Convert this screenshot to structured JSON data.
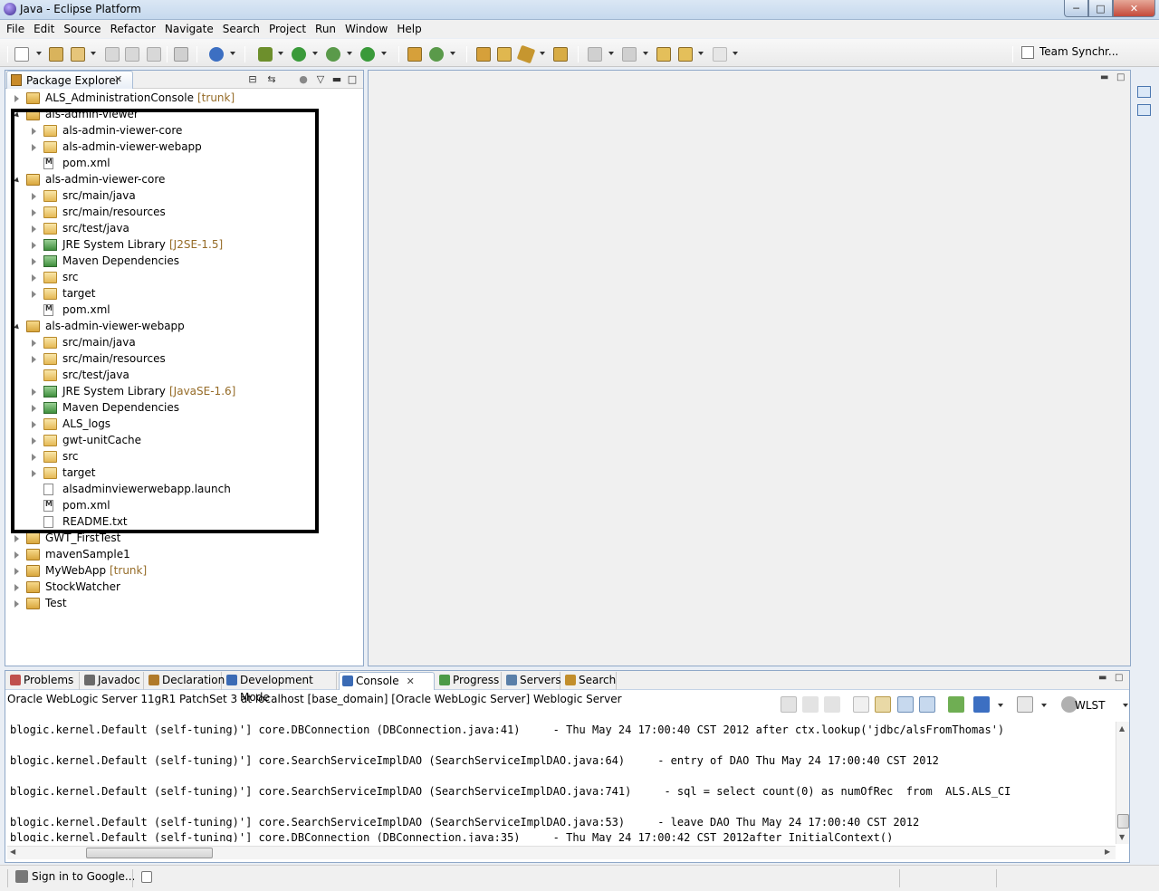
{
  "window": {
    "title": "Java - Eclipse Platform",
    "min_glyph": "─",
    "max_glyph": "□",
    "close_glyph": "✕"
  },
  "menu": [
    "File",
    "Edit",
    "Source",
    "Refactor",
    "Navigate",
    "Search",
    "Project",
    "Run",
    "Window",
    "Help"
  ],
  "toolbar": {
    "team_sync_label": "Team Synchr..."
  },
  "package_explorer": {
    "tab_label": "Package Explorer",
    "close_glyph": "✕",
    "tree": [
      {
        "label": "ALS_AdministrationConsole",
        "decoration": "[trunk]",
        "level": 0,
        "state": "closed",
        "icon": "project-icon"
      },
      {
        "label": "als-admin-viewer",
        "decoration": "",
        "level": 0,
        "state": "open",
        "icon": "maven-project-icon"
      },
      {
        "label": "als-admin-viewer-core",
        "decoration": "",
        "level": 1,
        "state": "closed",
        "icon": "folder-icon"
      },
      {
        "label": "als-admin-viewer-webapp",
        "decoration": "",
        "level": 1,
        "state": "closed",
        "icon": "folder-icon"
      },
      {
        "label": "pom.xml",
        "decoration": "",
        "level": 1,
        "state": "none",
        "icon": "maven-xml-file-icon"
      },
      {
        "label": "als-admin-viewer-core",
        "decoration": "",
        "level": 0,
        "state": "open",
        "icon": "maven-project-icon"
      },
      {
        "label": "src/main/java",
        "decoration": "",
        "level": 1,
        "state": "closed",
        "icon": "source-folder-icon"
      },
      {
        "label": "src/main/resources",
        "decoration": "",
        "level": 1,
        "state": "closed",
        "icon": "source-folder-icon"
      },
      {
        "label": "src/test/java",
        "decoration": "",
        "level": 1,
        "state": "closed",
        "icon": "source-folder-icon"
      },
      {
        "label": "JRE System Library",
        "decoration": "[J2SE-1.5]",
        "level": 1,
        "state": "closed",
        "icon": "library-icon"
      },
      {
        "label": "Maven Dependencies",
        "decoration": "",
        "level": 1,
        "state": "closed",
        "icon": "library-icon"
      },
      {
        "label": "src",
        "decoration": "",
        "level": 1,
        "state": "closed",
        "icon": "folder-icon"
      },
      {
        "label": "target",
        "decoration": "",
        "level": 1,
        "state": "closed",
        "icon": "folder-icon"
      },
      {
        "label": "pom.xml",
        "decoration": "",
        "level": 1,
        "state": "none",
        "icon": "maven-xml-file-icon"
      },
      {
        "label": "als-admin-viewer-webapp",
        "decoration": "",
        "level": 0,
        "state": "open",
        "icon": "maven-project-icon"
      },
      {
        "label": "src/main/java",
        "decoration": "",
        "level": 1,
        "state": "closed",
        "icon": "source-folder-icon"
      },
      {
        "label": "src/main/resources",
        "decoration": "",
        "level": 1,
        "state": "closed",
        "icon": "source-folder-icon"
      },
      {
        "label": "src/test/java",
        "decoration": "",
        "level": 1,
        "state": "none",
        "icon": "source-folder-icon"
      },
      {
        "label": "JRE System Library",
        "decoration": "[JavaSE-1.6]",
        "level": 1,
        "state": "closed",
        "icon": "library-icon"
      },
      {
        "label": "Maven Dependencies",
        "decoration": "",
        "level": 1,
        "state": "closed",
        "icon": "library-icon"
      },
      {
        "label": "ALS_logs",
        "decoration": "",
        "level": 1,
        "state": "closed",
        "icon": "folder-icon"
      },
      {
        "label": "gwt-unitCache",
        "decoration": "",
        "level": 1,
        "state": "closed",
        "icon": "folder-icon"
      },
      {
        "label": "src",
        "decoration": "",
        "level": 1,
        "state": "closed",
        "icon": "folder-icon"
      },
      {
        "label": "target",
        "decoration": "",
        "level": 1,
        "state": "closed",
        "icon": "folder-icon"
      },
      {
        "label": "alsadminviewerwebapp.launch",
        "decoration": "",
        "level": 1,
        "state": "none",
        "icon": "file-icon"
      },
      {
        "label": "pom.xml",
        "decoration": "",
        "level": 1,
        "state": "none",
        "icon": "maven-xml-file-icon"
      },
      {
        "label": "README.txt",
        "decoration": "",
        "level": 1,
        "state": "none",
        "icon": "file-icon"
      },
      {
        "label": "GWT_FirstTest",
        "decoration": "",
        "level": 0,
        "state": "closed",
        "icon": "project-icon"
      },
      {
        "label": "mavenSample1",
        "decoration": "",
        "level": 0,
        "state": "closed",
        "icon": "project-icon"
      },
      {
        "label": "MyWebApp",
        "decoration": "[trunk]",
        "level": 0,
        "state": "closed",
        "icon": "project-icon"
      },
      {
        "label": "StockWatcher",
        "decoration": "",
        "level": 0,
        "state": "closed",
        "icon": "project-icon"
      },
      {
        "label": "Test",
        "decoration": "",
        "level": 0,
        "state": "closed",
        "icon": "project-icon"
      }
    ]
  },
  "bottom_panel": {
    "tabs": [
      {
        "label": "Problems",
        "icon": "problems-icon",
        "color": "#c0504d"
      },
      {
        "label": "Javadoc",
        "icon": "javadoc-icon",
        "color": "#6a6a6a"
      },
      {
        "label": "Declaration",
        "icon": "declaration-icon",
        "color": "#b07a2a"
      },
      {
        "label": "Development Mode",
        "icon": "gwt-dev-mode-icon",
        "color": "#3b6bb5"
      },
      {
        "label": "Console",
        "icon": "console-icon",
        "color": "#3b6bb5",
        "active": true
      },
      {
        "label": "Progress",
        "icon": "progress-icon",
        "color": "#4c9a46"
      },
      {
        "label": "Servers",
        "icon": "servers-icon",
        "color": "#5a7fa8"
      },
      {
        "label": "Search",
        "icon": "search-icon",
        "color": "#c28e2c"
      }
    ],
    "close_glyph": "✕",
    "console_description": "Oracle WebLogic Server 11gR1 PatchSet 3 at localhost [base_domain] [Oracle WebLogic Server] Weblogic Server",
    "wlst_label": "WLST",
    "lines": [
      "blogic.kernel.Default (self-tuning)'] core.DBConnection (DBConnection.java:41)     - Thu May 24 17:00:40 CST 2012 after ctx.lookup('jdbc/alsFromThomas')",
      "",
      "blogic.kernel.Default (self-tuning)'] core.SearchServiceImplDAO (SearchServiceImplDAO.java:64)     - entry of DAO Thu May 24 17:00:40 CST 2012",
      "",
      "blogic.kernel.Default (self-tuning)'] core.SearchServiceImplDAO (SearchServiceImplDAO.java:741)     - sql = select count(0) as numOfRec  from  ALS.ALS_CI",
      "",
      "blogic.kernel.Default (self-tuning)'] core.SearchServiceImplDAO (SearchServiceImplDAO.java:53)     - leave DAO Thu May 24 17:00:40 CST 2012",
      "blogic.kernel.Default (self-tuning)'] core.DBConnection (DBConnection.java:35)     - Thu May 24 17:00:42 CST 2012after InitialContext()"
    ]
  },
  "statusbar": {
    "signin_label": "Sign in to Google..."
  }
}
